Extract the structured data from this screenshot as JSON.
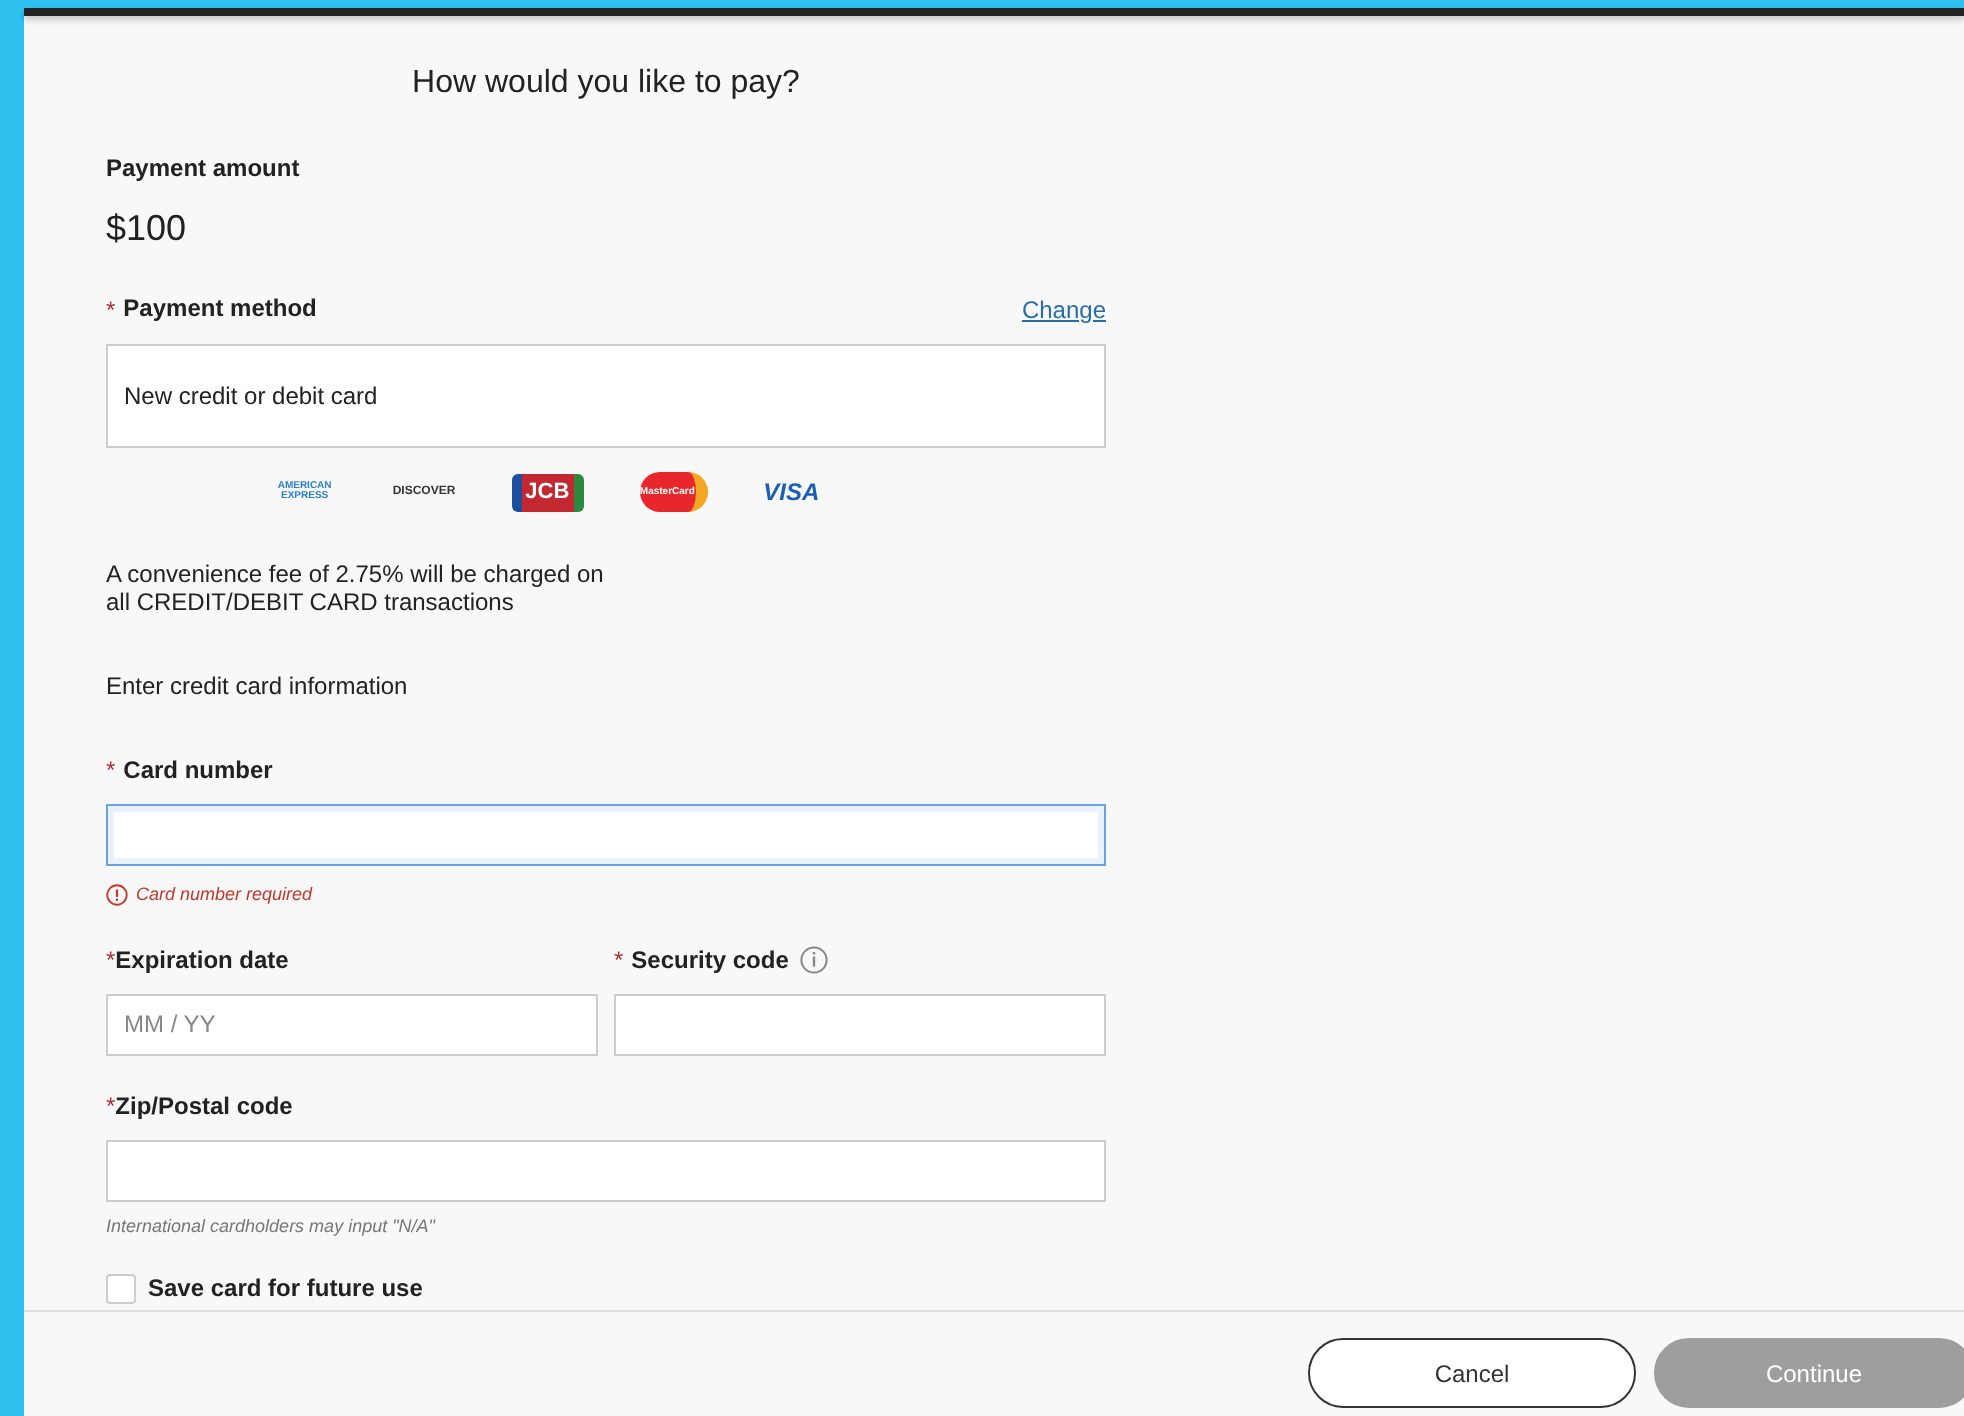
{
  "title": "How would you like to pay?",
  "payment_amount": {
    "label": "Payment amount",
    "value": "$100"
  },
  "payment_method": {
    "required_mark": "*",
    "label": "Payment method",
    "change_link": "Change",
    "value": "New credit or debit card"
  },
  "card_logos": [
    {
      "kind": "amex",
      "text": "AMERICAN EXPRESS"
    },
    {
      "kind": "discover",
      "text": "DISCOVER"
    },
    {
      "kind": "jcb",
      "text": "JCB"
    },
    {
      "kind": "mastercard",
      "text": "MasterCard"
    },
    {
      "kind": "visa",
      "text": "VISA"
    }
  ],
  "fee_notice": "A convenience fee of 2.75% will be charged on all CREDIT/DEBIT CARD transactions",
  "section_heading": "Enter credit card information",
  "card_number": {
    "required_mark": "*",
    "label": "Card number",
    "focused": true,
    "error": "Card number required"
  },
  "expiration": {
    "required_mark": "*",
    "label": "Expiration date",
    "placeholder": "MM / YY"
  },
  "security_code": {
    "required_mark": "*",
    "label": "Security code",
    "info": true
  },
  "zip": {
    "required_mark": "*",
    "label": "Zip/Postal code",
    "hint": "International cardholders may input \"N/A\""
  },
  "save_card": {
    "label": "Save card for future use",
    "checked": false
  },
  "buttons": [
    {
      "label": "Cancel",
      "disabled": false
    },
    {
      "label": "Continue",
      "disabled": true
    }
  ]
}
